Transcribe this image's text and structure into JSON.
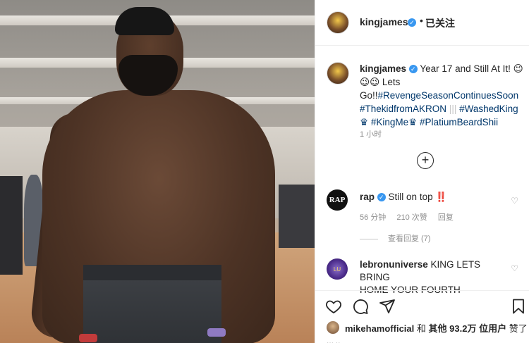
{
  "post": {
    "author": {
      "username": "kingjames",
      "verified_mark": "✓",
      "dot": "•",
      "follow_label": "已关注"
    },
    "caption": {
      "username": "kingjames",
      "line1": "Year 17 and Still At It! 😉",
      "line2": "😉😉 Lets",
      "line3_prefix": "Go!!",
      "tag1": "#RevengeSeasonContinuesSoon",
      "tag2": "#ThekidfromAKRON",
      "separator_bars": "|||",
      "tag3": "#WashedKing",
      "crown": "♛",
      "tag4": "#KingMe",
      "tag5": "#PlatiumBeardShii",
      "time": "1 小时"
    },
    "load_more_icon": "plus-circle-icon",
    "comments": [
      {
        "username": "rap",
        "avatar_text": "RAP",
        "text": "Still on top ‼️",
        "time": "56 分钟",
        "likes": "210 次赞",
        "reply": "回复",
        "view_replies": "查看回复 (7)"
      },
      {
        "username": "lebronuniverse",
        "avatar_text": "LU",
        "text_line1": "KING LETS BRING",
        "text_line2": "HOME YOUR FOURTH"
      }
    ],
    "actions": [
      "heart-icon",
      "comment-icon",
      "share-icon",
      "bookmark-icon"
    ],
    "likes": {
      "user": "mikehamofficial",
      "connector": "和",
      "others_label": "其他",
      "others_count": "93.2万",
      "users_label": "位用户",
      "liked_label": "赞了"
    },
    "cut_text": "··· ··"
  },
  "colors": {
    "link": "#00376b",
    "verified": "#3897f0",
    "muted": "#8e8e8e"
  }
}
